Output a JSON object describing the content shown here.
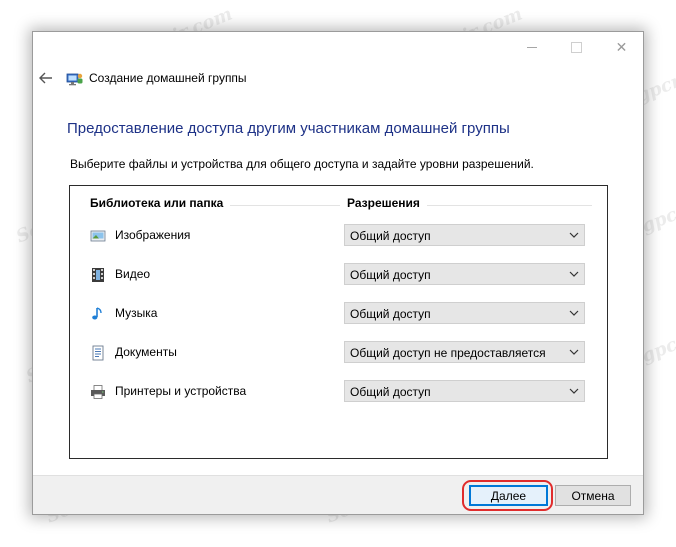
{
  "window": {
    "controls": {
      "minimize": "minimize",
      "maximize": "maximize",
      "close": "✕"
    }
  },
  "nav": {
    "back_icon": "back-arrow-icon",
    "app_icon": "homegroup-icon",
    "title": "Создание домашней группы"
  },
  "main": {
    "heading": "Предоставление доступа другим участникам домашней группы",
    "instruction": "Выберите файлы и устройства для общего доступа и задайте уровни разрешений.",
    "table": {
      "headers": {
        "library": "Библиотека или папка",
        "permissions": "Разрешения"
      },
      "rows": [
        {
          "icon": "pictures-icon",
          "label": "Изображения",
          "permission": "Общий доступ"
        },
        {
          "icon": "videos-icon",
          "label": "Видео",
          "permission": "Общий доступ"
        },
        {
          "icon": "music-icon",
          "label": "Музыка",
          "permission": "Общий доступ"
        },
        {
          "icon": "documents-icon",
          "label": "Документы",
          "permission": "Общий доступ не предоставляется"
        },
        {
          "icon": "printer-icon",
          "label": "Принтеры и устройства",
          "permission": "Общий доступ"
        }
      ]
    }
  },
  "footer": {
    "next_label": "Далее",
    "cancel_label": "Отмена"
  },
  "watermark": "Soringpcrepair.com",
  "colors": {
    "heading": "#1e3287",
    "highlight": "#e02c2c",
    "default_button_border": "#0078d7"
  }
}
